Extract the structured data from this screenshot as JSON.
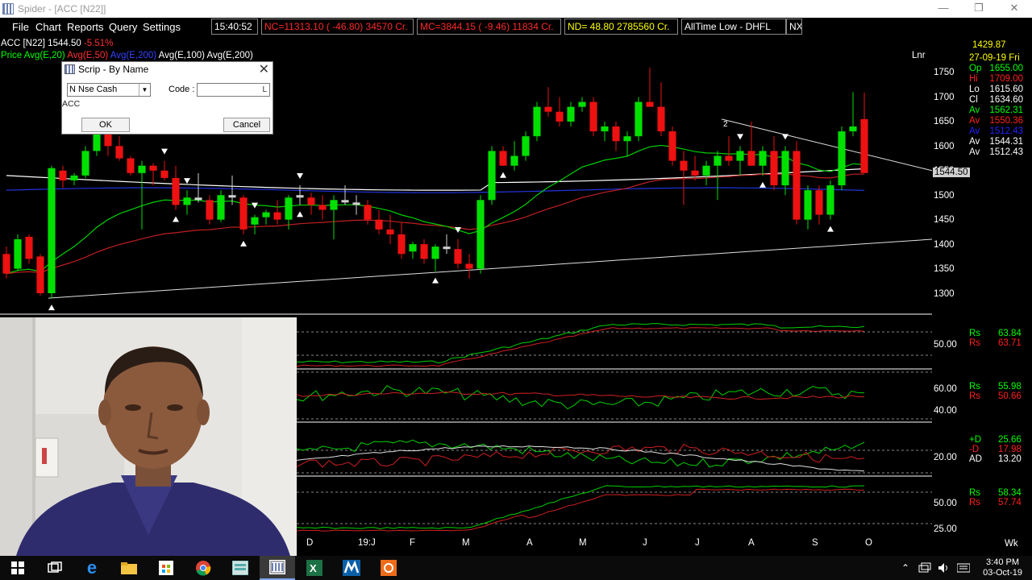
{
  "window": {
    "title": "Spider - [ACC [N22]]",
    "minimize": "—",
    "restore": "❐",
    "close": "✕"
  },
  "menu": [
    "File",
    "Chart",
    "Reports",
    "Query",
    "Settings"
  ],
  "ticker": [
    {
      "text": "15:40:52",
      "color": "#ffffff"
    },
    {
      "text": "NC=11313.10 ( -46.80) 34570 Cr.",
      "color": "#ff2a2a"
    },
    {
      "text": "MC=3844.15 ( -9.46) 11834 Cr.",
      "color": "#ff2a2a"
    },
    {
      "text": "ND=  48.80 2785560 Cr.",
      "color": "#ffff00"
    },
    {
      "text": "AllTime Low - DHFL",
      "color": "#ffffff"
    },
    {
      "text": "NX",
      "color": "#ffffff"
    }
  ],
  "chart_header": {
    "symbol": "ACC [N22]",
    "price": "1544.50",
    "change": "-5.51%",
    "legend_prefix": "Price",
    "averages": [
      "Avg(E,20)",
      "Avg(E,50)",
      "Avg(E,200)",
      "Avg(E,100)",
      "Avg(E,200)"
    ],
    "scale_mode": "Lnr"
  },
  "info_panel": {
    "cursor_price": "1429.87",
    "date": "27-09-19 Fri",
    "rows": [
      {
        "label": "Op",
        "value": "1655.00",
        "color": "#00ff00"
      },
      {
        "label": "Hi",
        "value": "1709.00",
        "color": "#ff2020"
      },
      {
        "label": "Lo",
        "value": "1615.60",
        "color": "#ffffff"
      },
      {
        "label": "Cl",
        "value": "1634.60",
        "color": "#ffffff"
      },
      {
        "label": "Av",
        "value": "1562.31",
        "color": "#00ff00"
      },
      {
        "label": "Av",
        "value": "1550.36",
        "color": "#ff2020"
      },
      {
        "label": "Av",
        "value": "1512.43",
        "color": "#2222ff"
      },
      {
        "label": "Av",
        "value": "1544.31",
        "color": "#ffffff"
      },
      {
        "label": "Av",
        "value": "1512.43",
        "color": "#ffffff"
      }
    ]
  },
  "price_axis": [
    "1750",
    "1700",
    "1650",
    "1600",
    "1550",
    "1500",
    "1450",
    "1400",
    "1350",
    "1300"
  ],
  "last_price_tag": "1544.50",
  "trendline_label": "2",
  "indicators": [
    {
      "axis": [
        "50.00"
      ],
      "values": [
        {
          "label": "Rs",
          "value": "63.84",
          "color": "#00ff00"
        },
        {
          "label": "Rs",
          "value": "63.71",
          "color": "#ff2020"
        }
      ]
    },
    {
      "axis": [
        "60.00",
        "40.00"
      ],
      "values": [
        {
          "label": "Rs",
          "value": "55.98",
          "color": "#00ff00"
        },
        {
          "label": "Rs",
          "value": "50.66",
          "color": "#ff2020"
        }
      ]
    },
    {
      "axis": [
        "20.00"
      ],
      "values": [
        {
          "label": "+D",
          "value": "25.66",
          "color": "#00ff00"
        },
        {
          "label": "-D",
          "value": "17.98",
          "color": "#ff2020"
        },
        {
          "label": "AD",
          "value": "13.20",
          "color": "#ffffff"
        }
      ]
    },
    {
      "axis": [
        "50.00",
        "25.00"
      ],
      "values": [
        {
          "label": "Rs",
          "value": "58.34",
          "color": "#00ff00"
        },
        {
          "label": "Rs",
          "value": "57.74",
          "color": "#ff2020"
        }
      ]
    }
  ],
  "time_axis": [
    "D",
    "19:J",
    "F",
    "M",
    "A",
    "M",
    "J",
    "J",
    "A",
    "S",
    "O"
  ],
  "period_label": "Wk",
  "chart_data": {
    "type": "candlestick",
    "symbol": "ACC [N22]",
    "yaxis_ticks": [
      1300,
      1350,
      1400,
      1450,
      1500,
      1550,
      1600,
      1650,
      1700,
      1750
    ],
    "last_close": 1544.5,
    "x_labels": [
      "D",
      "19:J",
      "F",
      "M",
      "A",
      "M",
      "J",
      "J",
      "A",
      "S",
      "O"
    ],
    "candles_ohlc": [
      [
        1380,
        1395,
        1330,
        1340
      ],
      [
        1350,
        1420,
        1345,
        1410
      ],
      [
        1415,
        1420,
        1360,
        1370
      ],
      [
        1375,
        1380,
        1295,
        1300
      ],
      [
        1300,
        1560,
        1290,
        1555
      ],
      [
        1550,
        1560,
        1515,
        1530
      ],
      [
        1530,
        1545,
        1520,
        1540
      ],
      [
        1540,
        1600,
        1535,
        1590
      ],
      [
        1590,
        1640,
        1580,
        1630
      ],
      [
        1625,
        1630,
        1580,
        1600
      ],
      [
        1600,
        1620,
        1570,
        1575
      ],
      [
        1575,
        1580,
        1540,
        1545
      ],
      [
        1545,
        1570,
        1430,
        1560
      ],
      [
        1560,
        1565,
        1520,
        1550
      ],
      [
        1550,
        1570,
        1530,
        1535
      ],
      [
        1535,
        1560,
        1470,
        1480
      ],
      [
        1480,
        1510,
        1460,
        1495
      ],
      [
        1495,
        1545,
        1485,
        1490
      ],
      [
        1490,
        1500,
        1440,
        1450
      ],
      [
        1450,
        1510,
        1445,
        1500
      ],
      [
        1500,
        1540,
        1480,
        1495
      ],
      [
        1495,
        1500,
        1420,
        1430
      ],
      [
        1440,
        1460,
        1420,
        1455
      ],
      [
        1455,
        1470,
        1440,
        1465
      ],
      [
        1465,
        1490,
        1440,
        1450
      ],
      [
        1450,
        1500,
        1430,
        1495
      ],
      [
        1495,
        1520,
        1480,
        1500
      ],
      [
        1495,
        1505,
        1460,
        1480
      ],
      [
        1480,
        1500,
        1450,
        1470
      ],
      [
        1470,
        1500,
        1410,
        1490
      ],
      [
        1490,
        1520,
        1480,
        1485
      ],
      [
        1485,
        1500,
        1460,
        1480
      ],
      [
        1480,
        1490,
        1440,
        1450
      ],
      [
        1450,
        1470,
        1420,
        1430
      ],
      [
        1430,
        1460,
        1400,
        1420
      ],
      [
        1420,
        1445,
        1370,
        1380
      ],
      [
        1385,
        1405,
        1370,
        1400
      ],
      [
        1400,
        1410,
        1360,
        1370
      ],
      [
        1370,
        1400,
        1345,
        1395
      ],
      [
        1395,
        1420,
        1380,
        1390
      ],
      [
        1390,
        1410,
        1350,
        1360
      ],
      [
        1360,
        1380,
        1330,
        1350
      ],
      [
        1350,
        1500,
        1340,
        1490
      ],
      [
        1490,
        1600,
        1480,
        1590
      ],
      [
        1590,
        1600,
        1560,
        1560
      ],
      [
        1560,
        1610,
        1550,
        1580
      ],
      [
        1580,
        1630,
        1570,
        1620
      ],
      [
        1620,
        1690,
        1610,
        1680
      ],
      [
        1680,
        1720,
        1660,
        1670
      ],
      [
        1670,
        1700,
        1640,
        1650
      ],
      [
        1650,
        1690,
        1640,
        1680
      ],
      [
        1680,
        1700,
        1670,
        1690
      ],
      [
        1690,
        1700,
        1620,
        1630
      ],
      [
        1630,
        1650,
        1610,
        1640
      ],
      [
        1640,
        1650,
        1590,
        1610
      ],
      [
        1610,
        1630,
        1580,
        1620
      ],
      [
        1620,
        1700,
        1610,
        1690
      ],
      [
        1690,
        1760,
        1680,
        1680
      ],
      [
        1680,
        1730,
        1620,
        1630
      ],
      [
        1630,
        1640,
        1560,
        1570
      ],
      [
        1570,
        1590,
        1480,
        1550
      ],
      [
        1550,
        1580,
        1530,
        1540
      ],
      [
        1540,
        1570,
        1520,
        1560
      ],
      [
        1560,
        1590,
        1490,
        1580
      ],
      [
        1580,
        1620,
        1560,
        1570
      ],
      [
        1570,
        1600,
        1540,
        1590
      ],
      [
        1590,
        1650,
        1560,
        1560
      ],
      [
        1560,
        1600,
        1540,
        1590
      ],
      [
        1590,
        1620,
        1510,
        1520
      ],
      [
        1520,
        1600,
        1500,
        1590
      ],
      [
        1590,
        1610,
        1440,
        1450
      ],
      [
        1450,
        1520,
        1430,
        1510
      ],
      [
        1510,
        1520,
        1440,
        1460
      ],
      [
        1460,
        1530,
        1450,
        1520
      ],
      [
        1520,
        1640,
        1510,
        1630
      ],
      [
        1630,
        1710,
        1620,
        1640
      ],
      [
        1655,
        1709,
        1615,
        1545
      ]
    ]
  },
  "dialog": {
    "title": "Scrip - By Name",
    "close": "✕",
    "exchange": "N Nse Cash",
    "code_label": "Code :",
    "code_value": "L",
    "hint": "ACC",
    "ok": "OK",
    "cancel": "Cancel"
  },
  "taskbar": {
    "icons": [
      "windows-start",
      "task-view",
      "edge",
      "file-explorer",
      "store",
      "chrome",
      "app-window",
      "spider",
      "excel",
      "metastock",
      "recorder"
    ],
    "time": "3:40 PM",
    "date": "03-Oct-19"
  }
}
